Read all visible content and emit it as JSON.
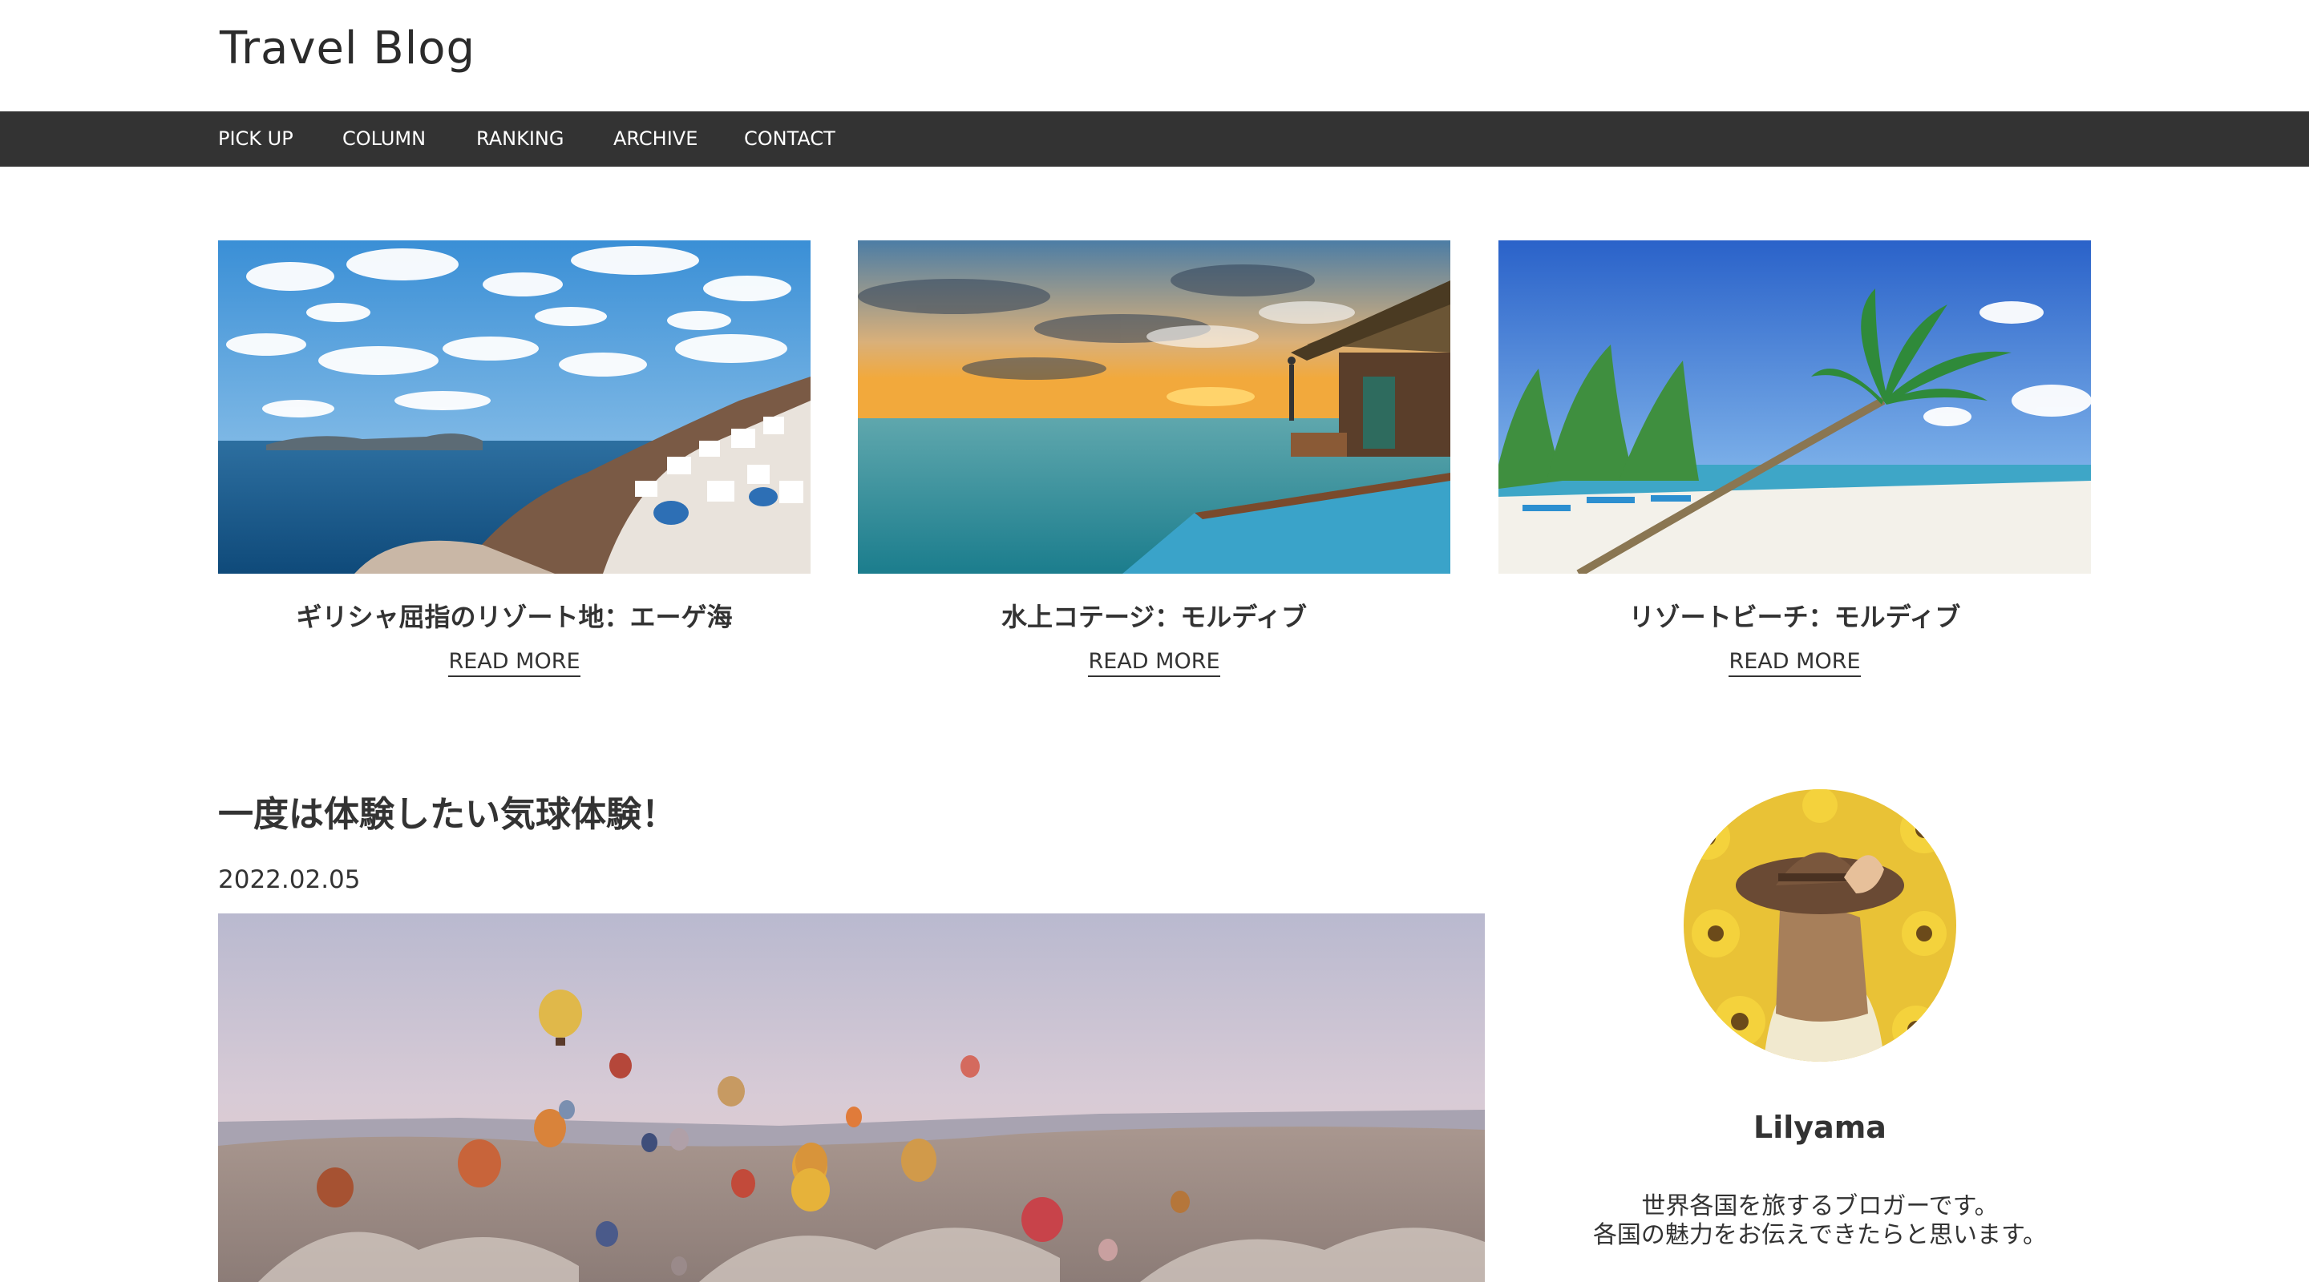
{
  "site": {
    "title": "Travel Blog"
  },
  "nav": {
    "items": [
      {
        "label": "PICK UP"
      },
      {
        "label": "COLUMN"
      },
      {
        "label": "RANKING"
      },
      {
        "label": "ARCHIVE"
      },
      {
        "label": "CONTACT"
      }
    ]
  },
  "features": [
    {
      "title": "ギリシャ屈指のリゾート地：エーゲ海",
      "read_more": "READ MORE",
      "image": "santorini-photo"
    },
    {
      "title": "水上コテージ：モルディブ",
      "read_more": "READ MORE",
      "image": "water-cottage-photo"
    },
    {
      "title": "リゾートビーチ：モルディブ",
      "read_more": "READ MORE",
      "image": "beach-palm-photo"
    }
  ],
  "post": {
    "title": "一度は体験したい気球体験！",
    "date": "2022.02.05",
    "image": "hot-air-balloons-photo"
  },
  "profile": {
    "name": "Lilyama",
    "bio": [
      "世界各国を旅するブロガーです。",
      "各国の魅力をお伝えできたらと思います。"
    ],
    "avatar": "woman-in-sunflower-field-photo"
  },
  "colors": {
    "nav_background": "#333333",
    "text": "#333333",
    "background": "#ffffff"
  }
}
